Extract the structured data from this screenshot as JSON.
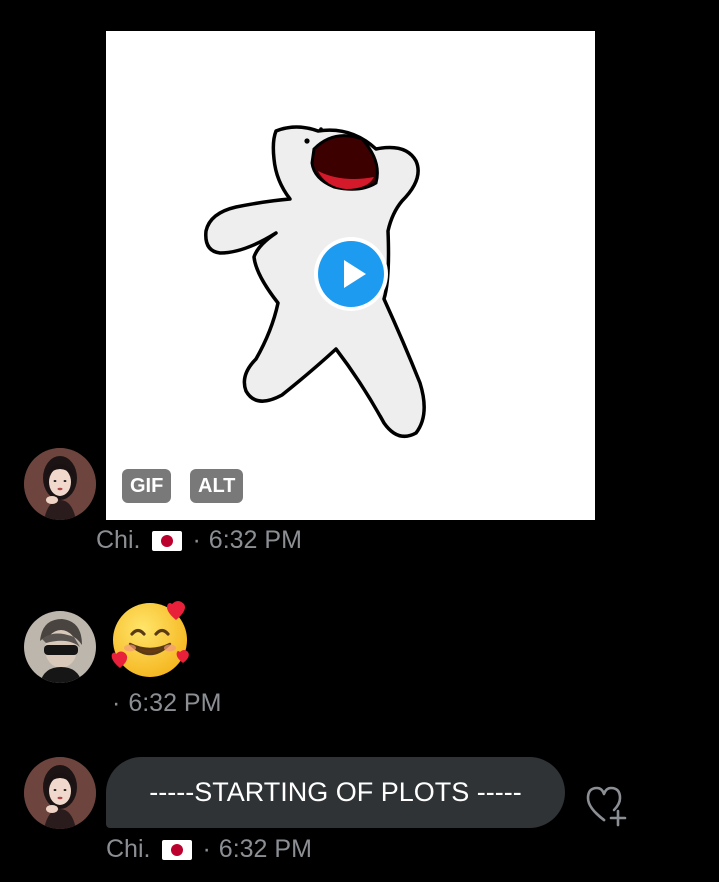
{
  "messages": [
    {
      "media": {
        "badges": {
          "gif": "GIF",
          "alt": "ALT"
        }
      },
      "sender": "Chi.",
      "separator": "·",
      "time": "6:32 PM"
    },
    {
      "emoji": "smiling-face-with-hearts",
      "separator": "·",
      "time": "6:32 PM"
    },
    {
      "text": "-----STARTING OF PLOTS -----",
      "sender": "Chi.",
      "separator": "·",
      "time": "6:32 PM"
    }
  ],
  "icons": {
    "play": "play-icon",
    "react": "heart-plus-icon",
    "flag": "japan-flag"
  },
  "colors": {
    "background": "#000000",
    "bubble": "#2f3336",
    "meta_text": "#8b8f94",
    "accent": "#1d9bf0"
  }
}
